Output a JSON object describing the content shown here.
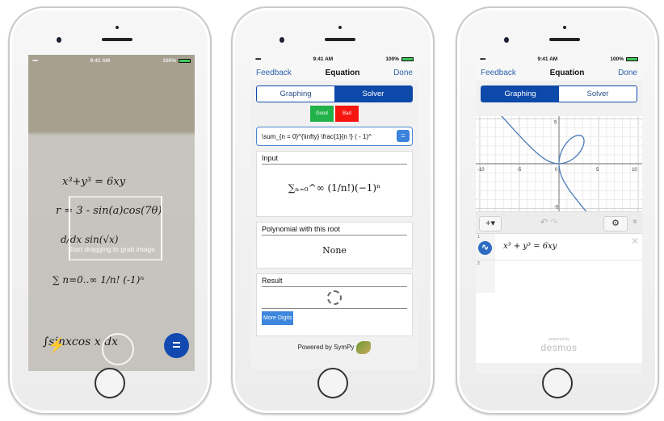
{
  "status_bar": {
    "signal": "•••••",
    "wifi_icon": "wifi-icon",
    "time": "9:41 AM",
    "battery_percent": "100%"
  },
  "camera_screen": {
    "handwritten_equations": [
      "x³+y³ = 6xy",
      "r = 3 - sin(a)cos(7θ)",
      "d/dx sin(√x)",
      "∑ n=0..∞ 1/n! (-1)ⁿ",
      "∫sinxcos x dx"
    ],
    "grab_hint": "Start dragging to grab image",
    "equals_button": "="
  },
  "solver_screen": {
    "nav": {
      "left": "Feedback",
      "title": "Equation",
      "right": "Done"
    },
    "tabs": [
      {
        "label": "Graphing",
        "active": false
      },
      {
        "label": "Solver",
        "active": true
      }
    ],
    "feedback": {
      "good": "Good",
      "bad": "Bad"
    },
    "latex_input": "\\sum_{n = 0}^{\\infty} \\frac{1}{n !} ( - 1)^",
    "submit_label": "=",
    "cards": [
      {
        "title": "Input",
        "content": "∑ₙ₌₀^∞ (1/n!)(−1)ⁿ"
      },
      {
        "title": "Polynomial with this root",
        "content": "None"
      },
      {
        "title": "Result",
        "content": "",
        "loading": true,
        "button": "More Digits"
      }
    ],
    "footer": "Powered by SymPy"
  },
  "graph_screen": {
    "nav": {
      "left": "Feedback",
      "title": "Equation",
      "right": "Done"
    },
    "tabs": [
      {
        "label": "Graphing",
        "active": true
      },
      {
        "label": "Solver",
        "active": false
      }
    ],
    "axis_labels": {
      "x": [
        "-10",
        "-5",
        "0",
        "5",
        "10"
      ],
      "y": [
        "5",
        "-5"
      ]
    },
    "toolbar": {
      "add": "+▾",
      "undo": "↶",
      "redo": "↷",
      "settings": "⚙",
      "collapse": "»"
    },
    "expressions": [
      {
        "index": "1",
        "latex": "x³ + y³ = 6xy"
      },
      {
        "index": "2",
        "latex": ""
      }
    ],
    "branding": {
      "small": "powered by",
      "big": "desmos"
    }
  }
}
